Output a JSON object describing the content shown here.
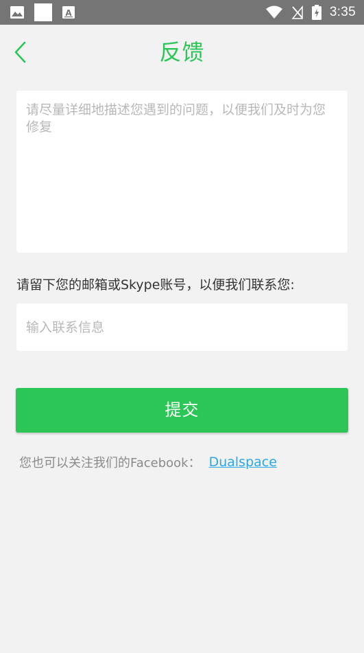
{
  "status_bar": {
    "time": "3:35",
    "icons_left": [
      "image-icon",
      "blank-notification-icon",
      "text-notification-icon"
    ],
    "icons_right": [
      "wifi-icon",
      "no-signal-icon",
      "battery-charging-icon"
    ]
  },
  "header": {
    "back_icon": "chevron-left-icon",
    "title": "反馈"
  },
  "feedback": {
    "placeholder": "请尽量详细地描述您遇到的问题，以便我们及时为您修复",
    "value": ""
  },
  "contact": {
    "label": "请留下您的邮箱或Skype账号，以便我们联系您:",
    "placeholder": "输入联系信息",
    "value": ""
  },
  "submit": {
    "label": "提交"
  },
  "facebook": {
    "text": "您也可以关注我们的Facebook：",
    "link_label": "Dualspace"
  },
  "colors": {
    "accent": "#2bc655",
    "link": "#2aa7e6",
    "status_bar": "#757575",
    "background": "#f2f2f2"
  }
}
